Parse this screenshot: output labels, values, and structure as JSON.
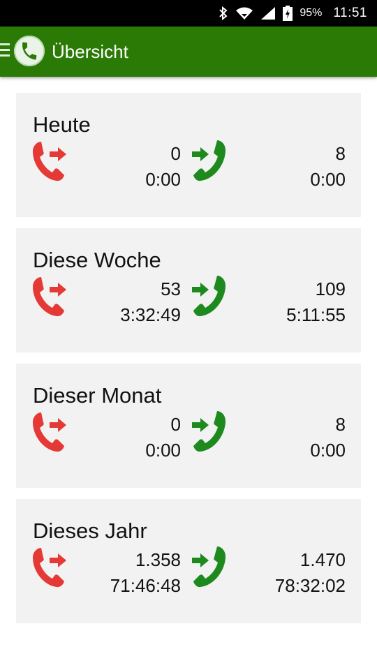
{
  "status_bar": {
    "battery_percent": "95%",
    "time": "11:51",
    "icons": [
      "bluetooth-icon",
      "wifi-icon",
      "cell-signal-icon",
      "battery-charging-icon"
    ]
  },
  "app_bar": {
    "title": "Übersicht",
    "color": "#2a7a05"
  },
  "colors": {
    "outgoing": "#e53935",
    "incoming": "#1e8a1e",
    "card_background": "#f2f2f2"
  },
  "cards": [
    {
      "title": "Heute",
      "outgoing_count": "0",
      "outgoing_duration": "0:00",
      "incoming_count": "8",
      "incoming_duration": "0:00"
    },
    {
      "title": "Diese Woche",
      "outgoing_count": "53",
      "outgoing_duration": "3:32:49",
      "incoming_count": "109",
      "incoming_duration": "5:11:55"
    },
    {
      "title": "Dieser Monat",
      "outgoing_count": "0",
      "outgoing_duration": "0:00",
      "incoming_count": "8",
      "incoming_duration": "0:00"
    },
    {
      "title": "Dieses Jahr",
      "outgoing_count": "1.358",
      "outgoing_duration": "71:46:48",
      "incoming_count": "1.470",
      "incoming_duration": "78:32:02"
    }
  ]
}
